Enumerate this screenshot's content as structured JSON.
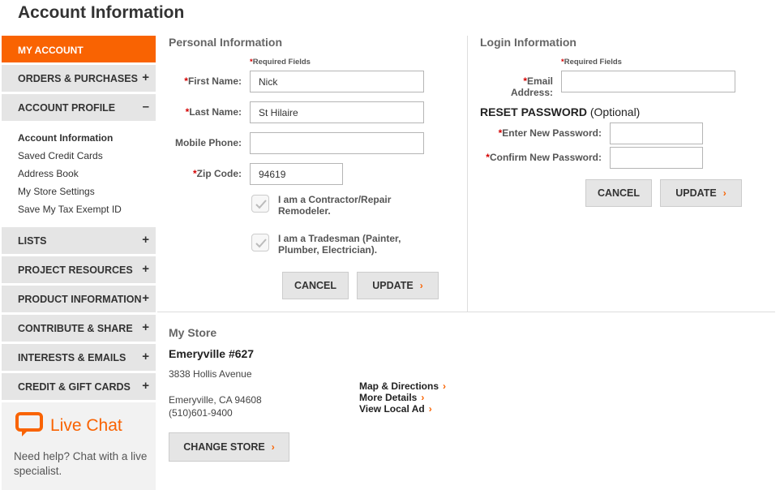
{
  "page": {
    "title": "Account Information"
  },
  "sidebar": {
    "active": "MY ACCOUNT",
    "items_top": [
      {
        "label": "ORDERS & PURCHASES",
        "sign": "+"
      },
      {
        "label": "ACCOUNT PROFILE",
        "sign": "–"
      }
    ],
    "subitems": [
      "Account Information",
      "Saved Credit Cards",
      "Address Book",
      "My Store Settings",
      "Save My Tax Exempt ID"
    ],
    "items_bottom": [
      {
        "label": "LISTS",
        "sign": "+"
      },
      {
        "label": "PROJECT RESOURCES",
        "sign": "+"
      },
      {
        "label": "PRODUCT INFORMATION",
        "sign": "+"
      },
      {
        "label": "CONTRIBUTE & SHARE",
        "sign": "+"
      },
      {
        "label": "INTERESTS & EMAILS",
        "sign": "+"
      },
      {
        "label": "CREDIT & GIFT CARDS",
        "sign": "+"
      }
    ],
    "livechat": {
      "title": "Live Chat",
      "text": "Need help? Chat with a live specialist."
    }
  },
  "personal": {
    "title": "Personal Information",
    "required_note": "Required Fields",
    "first_name_label": "First Name:",
    "first_name_value": "Nick",
    "last_name_label": "Last Name:",
    "last_name_value": "St Hilaire",
    "mobile_label": "Mobile Phone:",
    "mobile_value": "",
    "zip_label": "Zip Code:",
    "zip_value": "94619",
    "contractor_label_1": "I am a Contractor/Repair",
    "contractor_label_2": "Remodeler.",
    "tradesman_label_1": "I am a Tradesman (Painter,",
    "tradesman_label_2": "Plumber, Electrician).",
    "cancel": "CANCEL",
    "update": "UPDATE"
  },
  "login": {
    "title": "Login Information",
    "required_note": "Required Fields",
    "email_label_1": "Email",
    "email_label_2": "Address:",
    "email_value": "",
    "reset_title": "RESET PASSWORD",
    "reset_optional": "(Optional)",
    "new_password_label": "Enter New Password:",
    "confirm_password_label": "Confirm New Password:",
    "cancel": "CANCEL",
    "update": "UPDATE"
  },
  "store": {
    "title": "My Store",
    "name": "Emeryville #627",
    "address_line": "3838 Hollis Avenue",
    "city_line": "Emeryville, CA 94608",
    "phone": "(510)601-9400",
    "link_map": "Map & Directions",
    "link_details": "More Details",
    "link_ad": "View Local Ad",
    "change_button": "CHANGE STORE"
  },
  "colors": {
    "accent": "#f96302",
    "required": "#d40000",
    "nav_bg": "#e5e5e5"
  }
}
